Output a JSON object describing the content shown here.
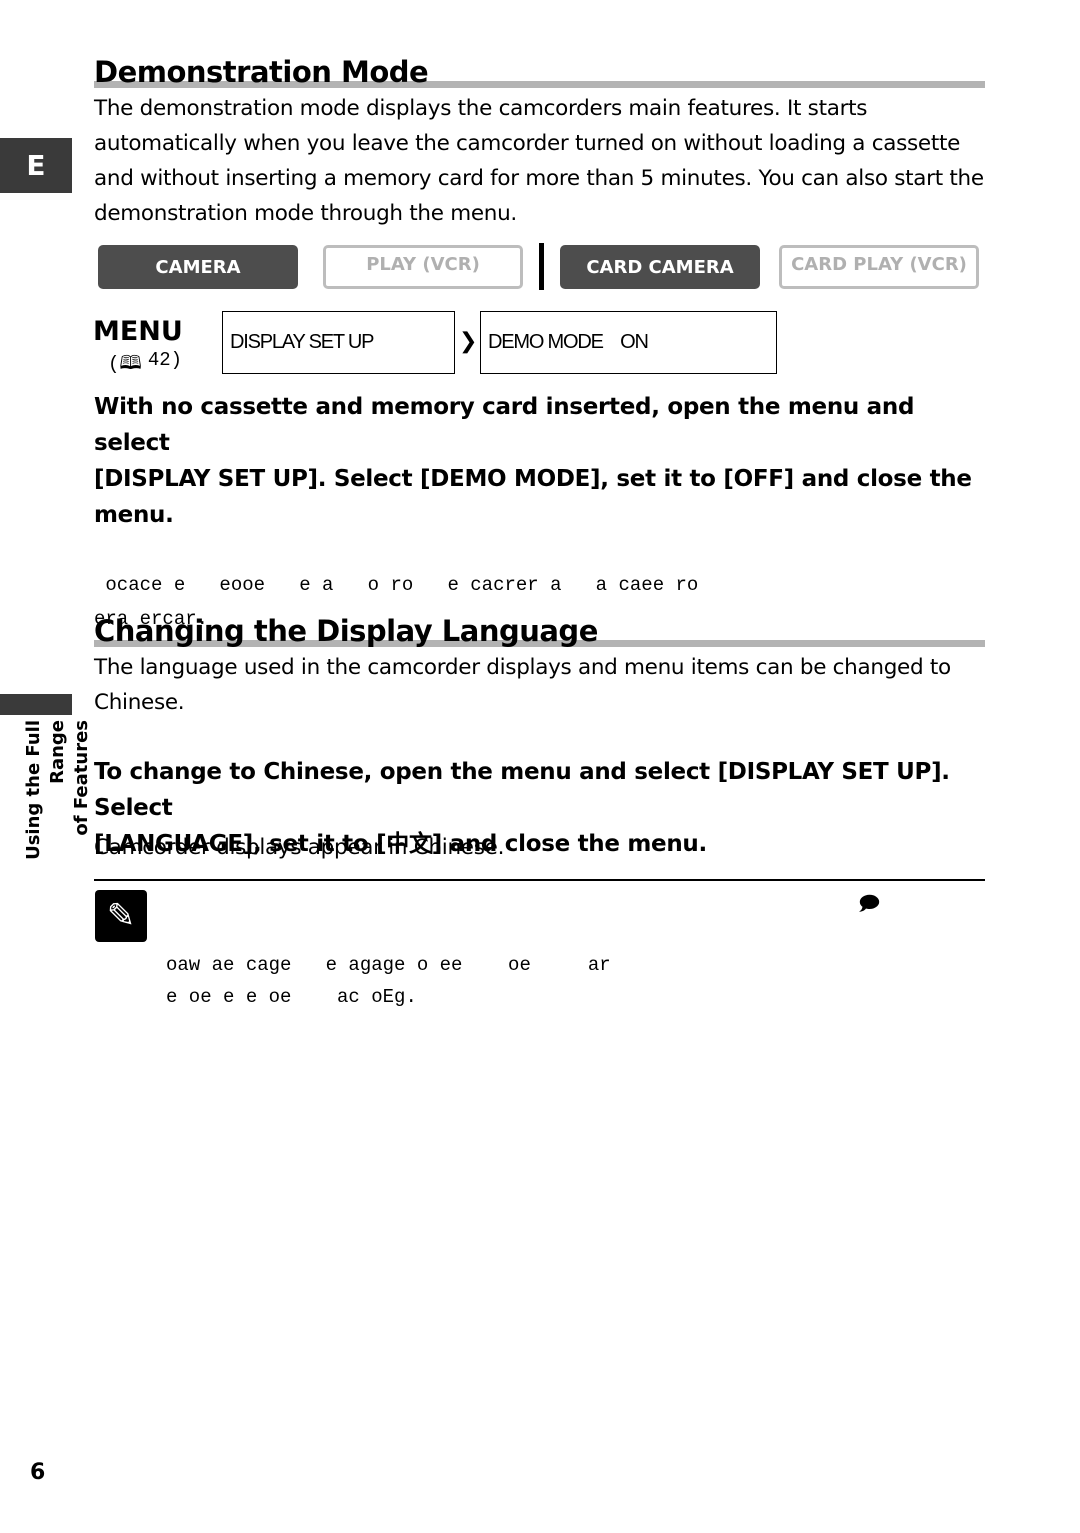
{
  "side_tab": {
    "letter": "E",
    "section_line1": "Using the Full Range",
    "section_line2": "of Features"
  },
  "section1": {
    "title": "Demonstration Mode",
    "body": [
      "The demonstration mode displays the camcorders main features. It starts",
      "automatically when you leave the camcorder turned on without loading a cassette",
      "and without inserting a memory card for more than 5 minutes. You can also start the",
      "demonstration mode through the menu."
    ]
  },
  "modes": [
    {
      "label": "CAMERA",
      "active": true
    },
    {
      "label": "PLAY (VCR)",
      "active": false
    },
    {
      "label": "CARD CAMERA",
      "active": true
    },
    {
      "label": "CARD PLAY (VCR)",
      "active": false
    }
  ],
  "menu": {
    "label": "MENU",
    "ref": "42)",
    "item1": "DISPLAY SET UP",
    "item2": "DEMO MODE    ON"
  },
  "instruction1": [
    "With no cassette and memory card inserted, open the menu and select",
    "[DISPLAY SET UP]. Select [DEMO MODE], set it to [OFF] and close the",
    "menu."
  ],
  "garbled1": [
    " ocace e   eooe   e a   o ro   e cacrer a   a caee ro",
    "era ercar."
  ],
  "section2": {
    "title": "Changing the Display Language",
    "body": [
      "The language used in the camcorder displays and menu items can be changed to",
      "Chinese."
    ]
  },
  "instruction2": [
    "To change to Chinese, open the menu and select [DISPLAY SET UP]. Select",
    "[LANGUAGE], set it to [中文] and close the menu."
  ],
  "result": "Camcorder displays appear in Chinese.",
  "note": {
    "line1": "oaw ae cage   e agage o ee    oe     ar",
    "line2": "e oe e e oe    ac oEg."
  },
  "page_number": "6"
}
